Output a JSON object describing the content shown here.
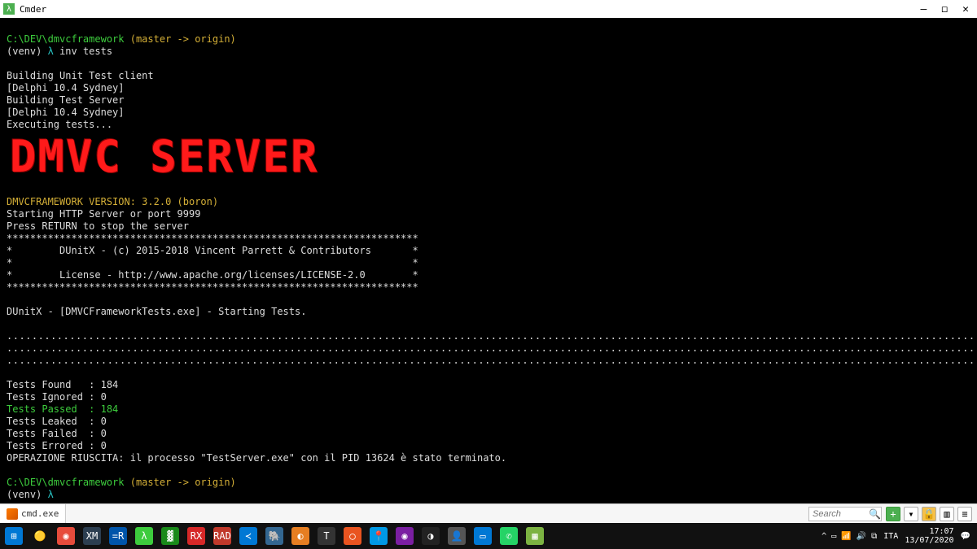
{
  "window": {
    "title": "Cmder"
  },
  "prompt1": {
    "path": "C:\\DEV\\dmvcframework",
    "branch": "(master -> origin)",
    "venv": "(venv)",
    "lambda": "λ",
    "command": "inv tests"
  },
  "build": {
    "l1": "Building Unit Test client",
    "l2": "[Delphi 10.4 Sydney]",
    "l3": "Building Test Server",
    "l4": "[Delphi 10.4 Sydney]",
    "l5": "Executing tests..."
  },
  "banner": "DMVC SERVER",
  "server": {
    "ver_label": "DMVCFRAMEWORK VERSION: 3.2.0 (boron)",
    "start": "Starting HTTP Server or port 9999",
    "stop": "Press RETURN to stop the server",
    "star_line": "**********************************************************************",
    "dunit_copy": "*        DUnitX - (c) 2015-2018 Vincent Parrett & Contributors       *",
    "blank_star": "*                                                                    *",
    "license": "*        License - http://www.apache.org/licenses/LICENSE-2.0        *",
    "starting": "DUnitX - [DMVCFrameworkTests.exe] - Starting Tests."
  },
  "dots": "...............................................................................................................................................................................................",
  "results": {
    "found": "Tests Found   : 184",
    "ignored": "Tests Ignored : 0",
    "passed": "Tests Passed  : 184",
    "leaked": "Tests Leaked  : 0",
    "failed": "Tests Failed  : 0",
    "errored": "Tests Errored : 0",
    "op": "OPERAZIONE RIUSCITA: il processo \"TestServer.exe\" con il PID 13624 è stato terminato."
  },
  "prompt2": {
    "path": "C:\\DEV\\dmvcframework",
    "branch": "(master -> origin)",
    "venv": "(venv)",
    "lambda": "λ"
  },
  "bottombar": {
    "tab": "cmd.exe",
    "search_placeholder": "Search"
  },
  "systray": {
    "lang": "ITA",
    "time": "17:07",
    "date": "13/07/2020"
  }
}
